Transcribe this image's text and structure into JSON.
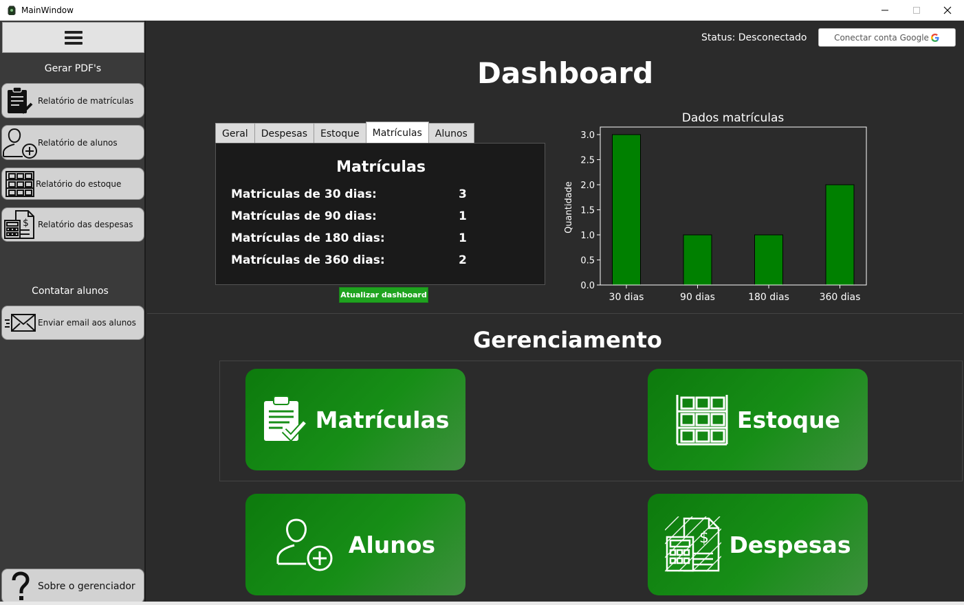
{
  "window": {
    "title": "MainWindow"
  },
  "sidebar": {
    "pdf_section_title": "Gerar PDF's",
    "pdf_items": [
      {
        "label": "Relatório de matrículas",
        "icon": "clipboard-check-icon"
      },
      {
        "label": "Relatório de alunos",
        "icon": "user-add-icon"
      },
      {
        "label": "Relatório do estoque",
        "icon": "shelves-icon"
      },
      {
        "label": "Relatório das despesas",
        "icon": "calculator-doc-icon"
      }
    ],
    "contact_section_title": "Contatar alunos",
    "contact_items": [
      {
        "label": "Enviar email aos alunos",
        "icon": "email-icon"
      }
    ],
    "about_label": "Sobre o gerenciador"
  },
  "header": {
    "status_label": "Status:",
    "status_value": "Desconectado",
    "google_button": "Conectar conta Google"
  },
  "dashboard": {
    "title": "Dashboard",
    "tabs": [
      "Geral",
      "Despesas",
      "Estoque",
      "Matrículas",
      "Alunos"
    ],
    "active_tab": "Matrículas",
    "panel_title": "Matrículas",
    "rows": [
      {
        "label": "Matriculas de 30 dias:",
        "value": "3"
      },
      {
        "label": "Matrículas de 90 dias:",
        "value": "1"
      },
      {
        "label": "Matrículas de 180 dias:",
        "value": "1"
      },
      {
        "label": "Matrículas de 360 dias:",
        "value": "2"
      }
    ],
    "refresh_button": "Atualizar dashboard"
  },
  "chart_data": {
    "type": "bar",
    "title": "Dados matrículas",
    "xlabel": "",
    "ylabel": "Quantidade",
    "categories": [
      "30 dias",
      "90 dias",
      "180 dias",
      "360 dias"
    ],
    "values": [
      3,
      1,
      1,
      2
    ],
    "ylim": [
      0,
      3.0
    ],
    "yticks": [
      "0.0",
      "0.5",
      "1.0",
      "1.5",
      "2.0",
      "2.5",
      "3.0"
    ],
    "bar_color": "#008000",
    "grid": false
  },
  "management": {
    "title": "Gerenciamento",
    "buttons": [
      {
        "label": "Matrículas",
        "icon": "clipboard-check-icon"
      },
      {
        "label": "Estoque",
        "icon": "shelves-icon"
      },
      {
        "label": "Alunos",
        "icon": "user-add-icon"
      },
      {
        "label": "Despesas",
        "icon": "calculator-doc-icon"
      }
    ]
  },
  "colors": {
    "accent_green": "#178e17",
    "background": "#2b2b2b",
    "sidebar": "#3a3a3a"
  }
}
